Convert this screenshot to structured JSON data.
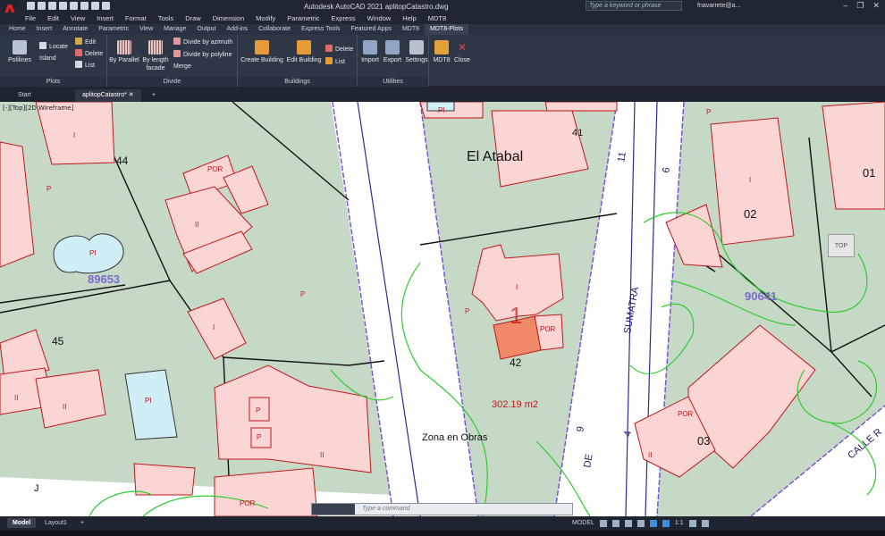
{
  "app": {
    "title": "Autodesk AutoCAD 2021    aplitopCatastro.dwg",
    "logo": "A"
  },
  "search": {
    "placeholder": "Type a keyword or phrase"
  },
  "user": {
    "name": "fnavarrete@a..."
  },
  "menu": [
    "File",
    "Edit",
    "View",
    "Insert",
    "Format",
    "Tools",
    "Draw",
    "Dimension",
    "Modify",
    "Parametric",
    "Express",
    "Window",
    "Help",
    "MDT8"
  ],
  "tabs": [
    "Home",
    "Insert",
    "Annotate",
    "Parametric",
    "View",
    "Manage",
    "Output",
    "Add-ins",
    "Collaborate",
    "Express Tools",
    "Featured Apps",
    "MDT8",
    "MDT8-Plots"
  ],
  "active_tab": "MDT8-Plots",
  "ribbon": {
    "plots": {
      "title": "Plots",
      "polilines": "Polilines",
      "locate": "Locate",
      "island": "Island",
      "edit": "Edit",
      "delete": "Delete",
      "list": "List"
    },
    "divide": {
      "title": "Divide",
      "by_parallel": "By Parallel",
      "by_length": "By length facade",
      "azimuth": "Divide by azimuth",
      "polyline": "Divide by polyline",
      "merge": "Merge"
    },
    "buildings": {
      "title": "Buildings",
      "create": "Create Building",
      "edit": "Edit Building",
      "delete": "Delete",
      "list": "List"
    },
    "utilities": {
      "title": "Utilities",
      "import": "Import",
      "export": "Export",
      "settings": "Settings",
      "mdt8": "MDT8",
      "close": "Close"
    }
  },
  "doc_tabs": {
    "start": "Start",
    "file": "aplitopCatastro*"
  },
  "viewport": {
    "label": "[-][Top][2D Wireframe]",
    "cube": "TOP",
    "wcs": "WCS"
  },
  "map_labels": {
    "el_atabal": "El Atabal",
    "n41": "41",
    "n44": "44",
    "n45": "45",
    "n42": "42",
    "n01": "01",
    "n02": "02",
    "n03": "03",
    "parcel1": "89653",
    "parcel2": "90641",
    "area": "302.19 m2",
    "zona": "Zona en Obras",
    "sumatra": "SUMATRA",
    "de": "DE",
    "calle": "CALLE R",
    "n11": "11",
    "n6": "6",
    "n9": "9",
    "n4": "4",
    "big1": "1",
    "J": "J",
    "por": "POR",
    "pi": "PI",
    "ii": "II",
    "i": "I",
    "p": "P"
  },
  "command": {
    "placeholder": "Type a command"
  },
  "status": {
    "model_tab": "Model",
    "layout_tab": "Layout1",
    "model": "MODEL",
    "scale": "1:1"
  },
  "colors": {
    "parcel_fill": "#c6d8c6",
    "building_fill": "#fbd4d4",
    "building_stroke": "#c01818",
    "contour": "#2ecc2e",
    "selected": "#f08a6a",
    "boundary": "#7a55d8"
  }
}
